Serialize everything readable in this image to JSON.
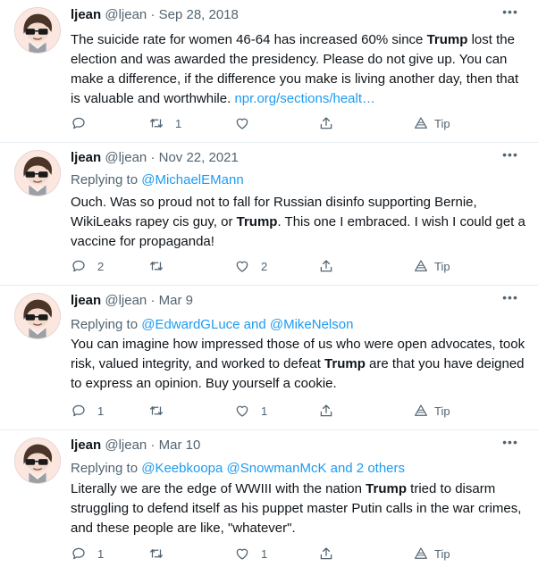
{
  "tweets": [
    {
      "name": "ljean",
      "handle": "@ljean",
      "date": "· Sep 28, 2018",
      "replying_prefix": "",
      "replying_to": "",
      "text_segments": [
        {
          "t": "The suicide rate for women 46-64 has increased 60% since "
        },
        {
          "t": "Trump",
          "b": true
        },
        {
          "t": " lost the election and was awarded the presidency. Please do not give up. You can make a difference, if the difference you make is living another day, then that is valuable and worthwhile. "
        },
        {
          "t": "npr.org/sections/healt…",
          "link": true
        }
      ],
      "reply_count": "",
      "retweet_count": "1",
      "like_count": "",
      "tip_label": "Tip"
    },
    {
      "name": "ljean",
      "handle": "@ljean",
      "date": "· Nov 22, 2021",
      "replying_prefix": "Replying to ",
      "replying_to": "@MichaelEMann",
      "text_segments": [
        {
          "t": "Ouch. Was so proud not to fall for Russian disinfo supporting Bernie, WikiLeaks rapey cis guy, or "
        },
        {
          "t": "Trump",
          "b": true
        },
        {
          "t": ". This one I embraced. I wish I could get a vaccine for propaganda!"
        }
      ],
      "reply_count": "2",
      "retweet_count": "",
      "like_count": "2",
      "tip_label": "Tip"
    },
    {
      "name": "ljean",
      "handle": "@ljean",
      "date": "· Mar 9",
      "replying_prefix": "Replying to ",
      "replying_to": "@EdwardGLuce and @MikeNelson",
      "text_segments": [
        {
          "t": "You can imagine how impressed those of us who were open advocates, took risk, valued integrity, and worked to defeat "
        },
        {
          "t": "Trump",
          "b": true
        },
        {
          "t": " are that you have deigned to express an opinion.  Buy yourself a cookie."
        }
      ],
      "reply_count": "1",
      "retweet_count": "",
      "like_count": "1",
      "tip_label": "Tip"
    },
    {
      "name": "ljean",
      "handle": "@ljean",
      "date": "· Mar 10",
      "replying_prefix": "Replying to ",
      "replying_to": "@Keebkoopa @SnowmanMcK and 2 others",
      "text_segments": [
        {
          "t": "Literally we are the edge of WWIII with the nation "
        },
        {
          "t": "Trump",
          "b": true
        },
        {
          "t": " tried to disarm struggling to defend itself as his puppet master Putin calls in the war crimes, and these people are like, \"whatever\"."
        }
      ],
      "reply_count": "1",
      "retweet_count": "",
      "like_count": "1",
      "tip_label": "Tip"
    }
  ],
  "colors": {
    "text": "#0f1419",
    "muted": "#536471",
    "link": "#1d9bf0",
    "divider": "#e6ecf0"
  },
  "icons": [
    "reply-icon",
    "retweet-icon",
    "like-icon",
    "share-icon",
    "tip-icon",
    "more-icon"
  ]
}
